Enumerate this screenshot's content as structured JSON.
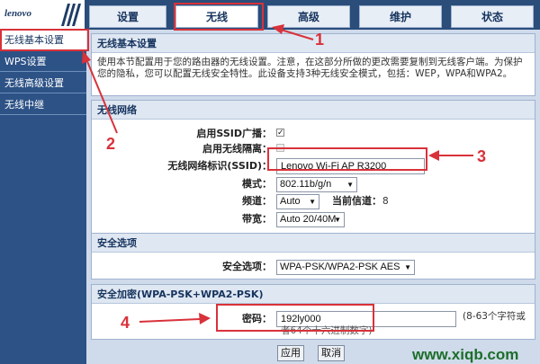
{
  "logo": {
    "text": "lenovo"
  },
  "tabs": [
    {
      "label": "设置"
    },
    {
      "label": "无线"
    },
    {
      "label": "高级"
    },
    {
      "label": "维护"
    },
    {
      "label": "状态"
    }
  ],
  "sidebar": {
    "items": [
      {
        "label": "无线基本设置"
      },
      {
        "label": "WPS设置"
      },
      {
        "label": "无线高级设置"
      },
      {
        "label": "无线中继"
      }
    ]
  },
  "basic": {
    "title": "无线基本设置",
    "desc": "使用本节配置用于您的路由器的无线设置。注意，在这部分所做的更改需要复制到无线客户端。为保护您的隐私，您可以配置无线安全特性。此设备支持3种无线安全模式，包括：WEP，WPA和WPA2。"
  },
  "network": {
    "title": "无线网络",
    "ssid_broadcast_label": "启用SSID广播：",
    "ssid_broadcast_checked": true,
    "isolation_label": "启用无线隔离：",
    "isolation_checked": false,
    "ssid_label": "无线网络标识(SSID)：",
    "ssid_value": "Lenovo Wi-Fi AP R3200",
    "mode_label": "模式：",
    "mode_value": "802.11b/g/n",
    "channel_label": "频道：",
    "channel_value": "Auto",
    "current_channel_label": "当前信道：",
    "current_channel_value": "8",
    "bandwidth_label": "带宽：",
    "bandwidth_value": "Auto 20/40M"
  },
  "security": {
    "title": "安全选项",
    "option_label": "安全选项：",
    "option_value": "WPA-PSK/WPA2-PSK AES"
  },
  "encryption": {
    "title": "安全加密(WPA-PSK+WPA2-PSK)",
    "password_label": "密码：",
    "password_value": "192ly000",
    "hint_line1": "(8-63个字符或",
    "hint_line2": "者64个十六进制数字)"
  },
  "buttons": {
    "apply": "应用",
    "cancel": "取消"
  },
  "annotations": {
    "n1": "1",
    "n2": "2",
    "n3": "3",
    "n4": "4"
  },
  "watermark": "www.xiqb.com",
  "colors": {
    "accent": "#2a4d7a",
    "annotation": "#d8323a",
    "watermark": "#1c6e2a"
  }
}
